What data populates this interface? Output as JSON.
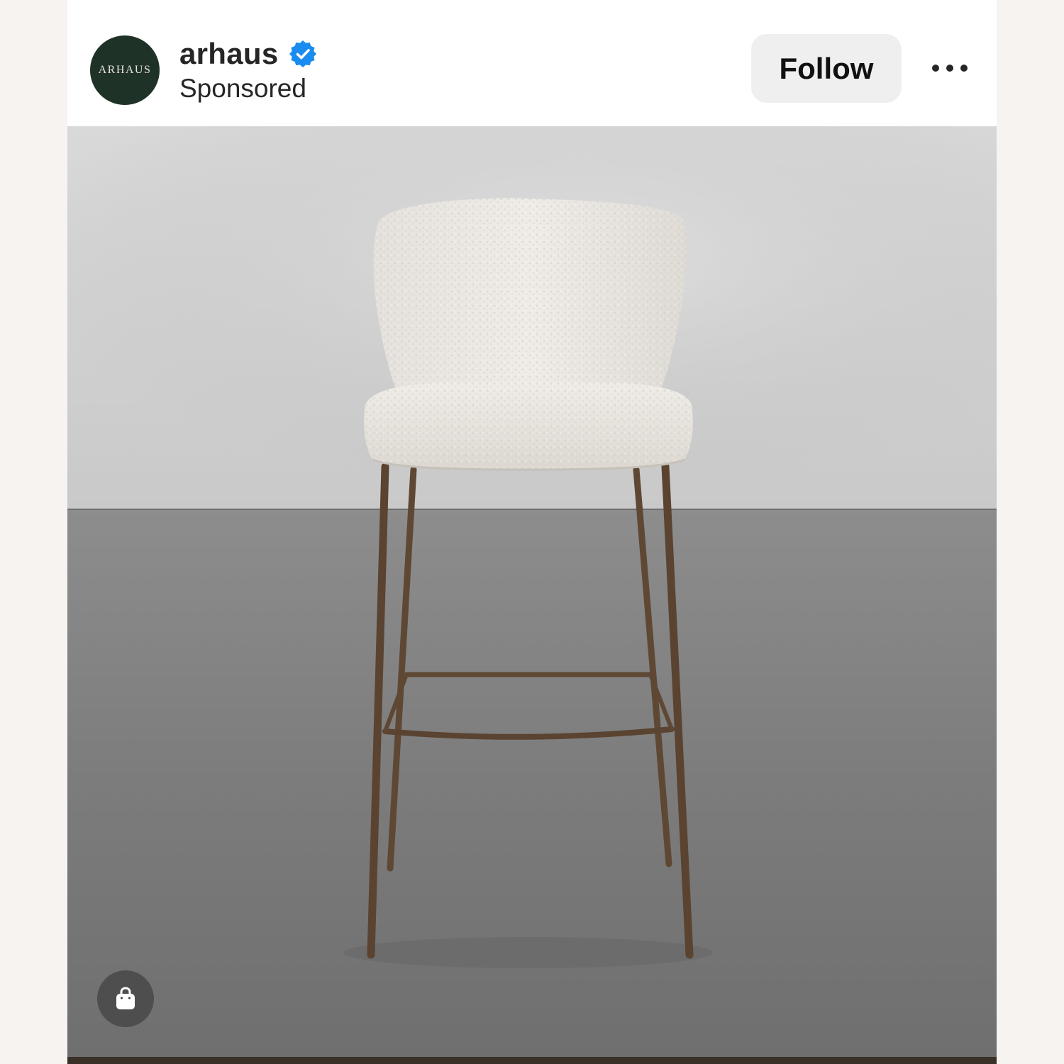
{
  "post": {
    "account_name": "arhaus",
    "avatar_wordmark": "ARHAUS",
    "sponsored_label": "Sponsored",
    "verified": true,
    "follow_label": "Follow",
    "more_icon": "more-horizontal-icon",
    "shop_icon": "shopping-bag-icon",
    "image_subject": "bouclé bar stool on bronze metal legs",
    "colors": {
      "verified": "#1a8cf0",
      "avatar_bg": "#1f3228",
      "follow_bg": "#efefef",
      "text": "#262626"
    }
  }
}
